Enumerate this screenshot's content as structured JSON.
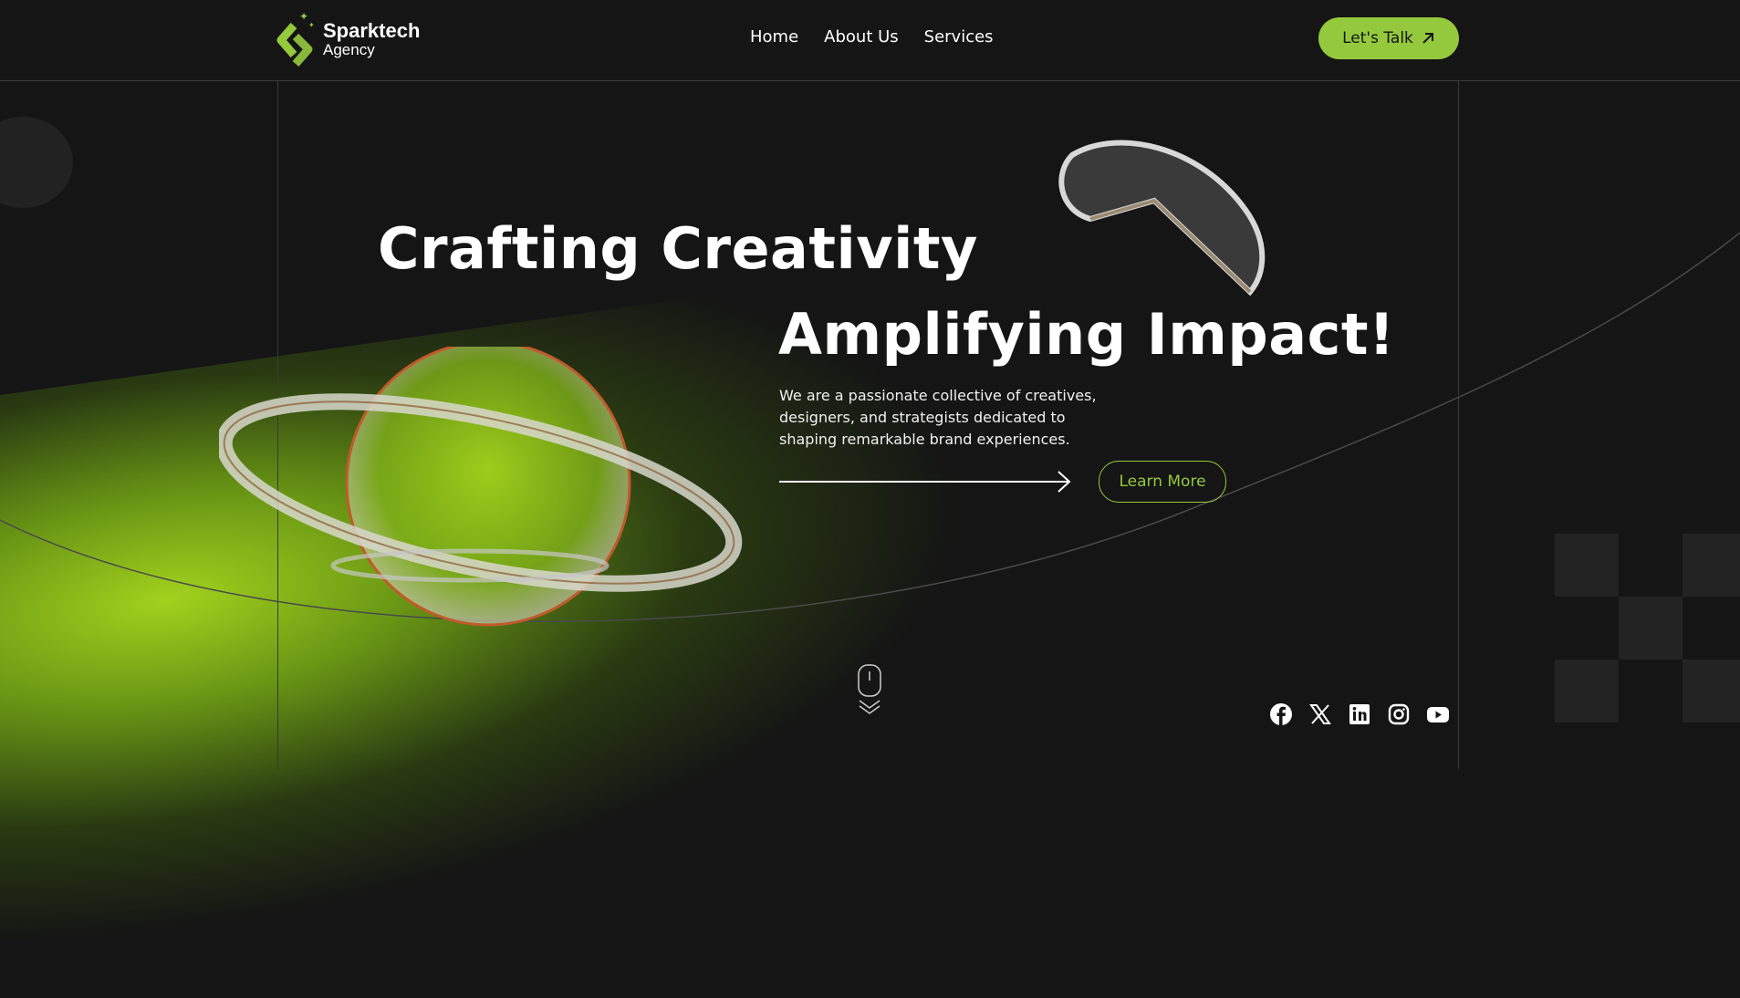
{
  "brand": {
    "name": "Sparktech",
    "subtitle": "Agency"
  },
  "nav": {
    "items": [
      "Home",
      "About Us",
      "Services"
    ],
    "cta_label": "Let's Talk",
    "cta_icon": "arrow-up-right-icon"
  },
  "hero": {
    "headline_1": "Crafting Creativity",
    "headline_2": "Amplifying Impact!",
    "description": "We are a passionate collective of creatives, designers, and strategists dedicated to shaping remarkable brand experiences.",
    "learn_more_label": "Learn More"
  },
  "socials": [
    "facebook-icon",
    "x-icon",
    "linkedin-icon",
    "instagram-icon",
    "youtube-icon"
  ],
  "colors": {
    "accent": "#95c93d",
    "background": "#151515",
    "text": "#ffffff"
  }
}
